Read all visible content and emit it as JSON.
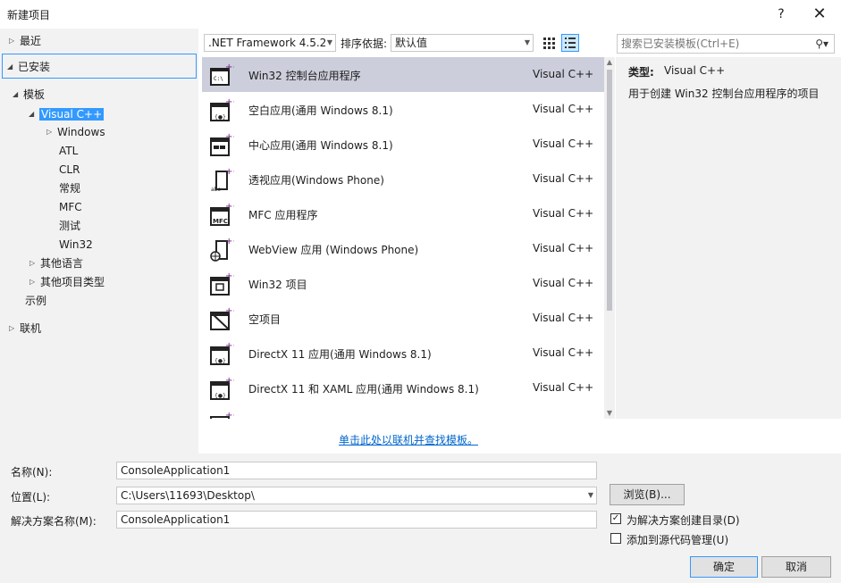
{
  "window": {
    "title": "新建项目",
    "help": "?",
    "close": "✕"
  },
  "tree": {
    "recent": "最近",
    "installed": "已安装",
    "templates": "模板",
    "visual_cpp": "Visual C++",
    "windows": "Windows",
    "atl": "ATL",
    "clr": "CLR",
    "general": "常规",
    "mfc": "MFC",
    "test": "测试",
    "win32": "Win32",
    "other_languages": "其他语言",
    "other_project_types": "其他项目类型",
    "samples": "示例",
    "online": "联机"
  },
  "toolbar": {
    "framework": ".NET Framework 4.5.2",
    "sort_label": "排序依据:",
    "sort_value": "默认值",
    "search_placeholder": "搜索已安装模板(Ctrl+E)"
  },
  "templates": [
    {
      "name": "Win32 控制台应用程序",
      "lang": "Visual C++",
      "icon": "console-app-icon"
    },
    {
      "name": "空白应用(通用 Windows 8.1)",
      "lang": "Visual C++",
      "icon": "blank-app-icon"
    },
    {
      "name": "中心应用(通用 Windows 8.1)",
      "lang": "Visual C++",
      "icon": "hub-app-icon"
    },
    {
      "name": "透视应用(Windows Phone)",
      "lang": "Visual C++",
      "icon": "pivot-app-icon"
    },
    {
      "name": "MFC 应用程序",
      "lang": "Visual C++",
      "icon": "mfc-app-icon"
    },
    {
      "name": "WebView 应用 (Windows Phone)",
      "lang": "Visual C++",
      "icon": "webview-app-icon"
    },
    {
      "name": "Win32 项目",
      "lang": "Visual C++",
      "icon": "win32-project-icon"
    },
    {
      "name": "空项目",
      "lang": "Visual C++",
      "icon": "empty-project-icon"
    },
    {
      "name": "DirectX 11 应用(通用 Windows 8.1)",
      "lang": "Visual C++",
      "icon": "directx-app-icon"
    },
    {
      "name": "DirectX 11 和 XAML 应用(通用 Windows 8.1)",
      "lang": "Visual C++",
      "icon": "directx-xaml-app-icon"
    }
  ],
  "details": {
    "type_label": "类型:",
    "type_value": "Visual C++",
    "description": "用于创建 Win32 控制台应用程序的项目"
  },
  "online_link": "单击此处以联机并查找模板。",
  "form": {
    "name_label": "名称(N):",
    "name_value": "ConsoleApplication1",
    "location_label": "位置(L):",
    "location_value": "C:\\Users\\11693\\Desktop\\",
    "solution_label": "解决方案名称(M):",
    "solution_value": "ConsoleApplication1",
    "browse": "浏览(B)...",
    "create_dir": "为解决方案创建目录(D)",
    "create_dir_checked": true,
    "add_source_control": "添加到源代码管理(U)",
    "add_source_control_checked": false,
    "ok": "确定",
    "cancel": "取消"
  },
  "colors": {
    "accent": "#3399ff",
    "selected_row": "#cccedb",
    "link": "#0066cc",
    "icon_purple": "#68217a"
  }
}
